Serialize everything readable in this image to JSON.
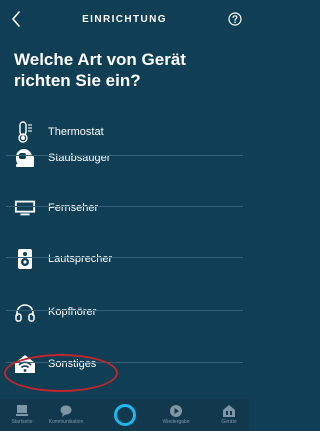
{
  "header": {
    "title": "EINRICHTUNG",
    "back_icon": "chevron-left-icon",
    "help_icon": "question-circle-icon"
  },
  "page_title_line1": "Welche Art von Gerät",
  "page_title_line2": "richten Sie ein?",
  "devices": [
    {
      "label": "Thermostat",
      "icon": "thermostat-icon"
    },
    {
      "label": "Staubsauger",
      "icon": "vacuum-icon"
    },
    {
      "label": "Fernseher",
      "icon": "tv-icon"
    },
    {
      "label": "Lautsprecher",
      "icon": "speaker-icon"
    },
    {
      "label": "Kopfhörer",
      "icon": "headphones-icon"
    },
    {
      "label": "Sonstiges",
      "icon": "wifi-home-icon"
    }
  ],
  "bottom_nav": [
    {
      "label": "Startseite",
      "icon": "home-card-icon"
    },
    {
      "label": "Kommunikation",
      "icon": "chat-icon"
    },
    {
      "label": "",
      "icon": "alexa-icon"
    },
    {
      "label": "Wiedergabe",
      "icon": "play-icon"
    },
    {
      "label": "Geräte",
      "icon": "devices-icon"
    }
  ],
  "colors": {
    "background": "#0f3e55",
    "divider": "#35617a",
    "highlight_circle": "#c0262d",
    "alexa_ring": "#1fb6ee"
  }
}
